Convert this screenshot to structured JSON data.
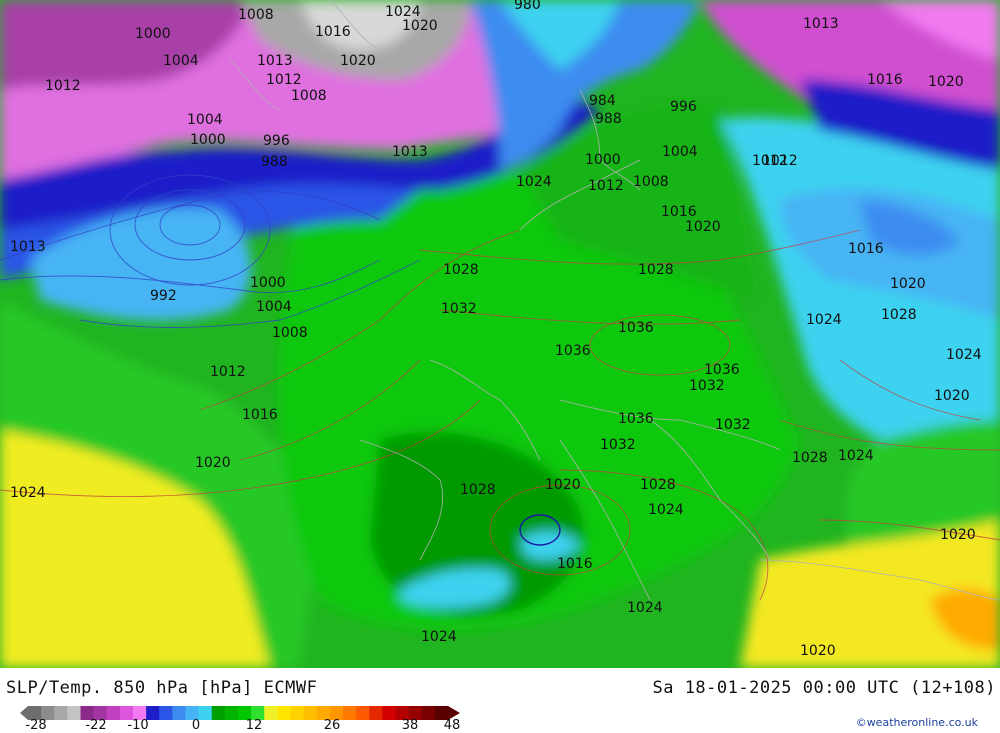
{
  "title_left": "SLP/Temp. 850 hPa [hPa] ECMWF",
  "title_right": "Sa 18-01-2025 00:00 UTC (12+108)",
  "copyright": "©weatheronline.co.uk",
  "colorbar": {
    "colors": [
      "#6e6e6e",
      "#8c8c8c",
      "#a8a8a8",
      "#c4c4c4",
      "#8a2b8a",
      "#a335a3",
      "#c040c0",
      "#dd55dd",
      "#f27af2",
      "#1e1ec8",
      "#2b55e6",
      "#3c8cf0",
      "#46b4f4",
      "#3cd2f0",
      "#00a000",
      "#00b400",
      "#00c800",
      "#30e030",
      "#f0f028",
      "#ffe600",
      "#ffd200",
      "#ffbe00",
      "#ffaa00",
      "#ff9600",
      "#ff7800",
      "#ff5a00",
      "#e62800",
      "#d20000",
      "#b40000",
      "#960000",
      "#780000",
      "#5a0000"
    ],
    "ticks": [
      "-28",
      "-22",
      "-10",
      "0",
      "12",
      "26",
      "38",
      "48"
    ]
  },
  "isobar_labels": [
    {
      "text": "1008"
    },
    {
      "text": "1024"
    },
    {
      "text": "1020"
    },
    {
      "text": "980"
    },
    {
      "text": "1000"
    },
    {
      "text": "1016"
    },
    {
      "text": "1004"
    },
    {
      "text": "1013"
    },
    {
      "text": "1020"
    },
    {
      "text": "1012"
    },
    {
      "text": "1012"
    },
    {
      "text": "1008"
    },
    {
      "text": "1004"
    },
    {
      "text": "1000"
    },
    {
      "text": "996"
    },
    {
      "text": "988"
    },
    {
      "text": "1013"
    },
    {
      "text": "984"
    },
    {
      "text": "988"
    },
    {
      "text": "996"
    },
    {
      "text": "1000"
    },
    {
      "text": "1004"
    },
    {
      "text": "1012"
    },
    {
      "text": "1024"
    },
    {
      "text": "1012"
    },
    {
      "text": "1008"
    },
    {
      "text": "1016"
    },
    {
      "text": "1020"
    },
    {
      "text": "1013"
    },
    {
      "text": "1016"
    },
    {
      "text": "1020"
    },
    {
      "text": "1013"
    },
    {
      "text": "1012"
    },
    {
      "text": "1016"
    },
    {
      "text": "992"
    },
    {
      "text": "1000"
    },
    {
      "text": "1004"
    },
    {
      "text": "1008"
    },
    {
      "text": "1028"
    },
    {
      "text": "1032"
    },
    {
      "text": "1028"
    },
    {
      "text": "1036"
    },
    {
      "text": "1036"
    },
    {
      "text": "1024"
    },
    {
      "text": "1028"
    },
    {
      "text": "1024"
    },
    {
      "text": "1012"
    },
    {
      "text": "1036"
    },
    {
      "text": "1032"
    },
    {
      "text": "1020"
    },
    {
      "text": "1016"
    },
    {
      "text": "1036"
    },
    {
      "text": "1032"
    },
    {
      "text": "1032"
    },
    {
      "text": "1028"
    },
    {
      "text": "1024"
    },
    {
      "text": "1020"
    },
    {
      "text": "1024"
    },
    {
      "text": "1028"
    },
    {
      "text": "1020"
    },
    {
      "text": "1028"
    },
    {
      "text": "1024"
    },
    {
      "text": "1016"
    },
    {
      "text": "1020"
    },
    {
      "text": "1020"
    },
    {
      "text": "1024"
    },
    {
      "text": "1024"
    },
    {
      "text": "1020"
    }
  ]
}
